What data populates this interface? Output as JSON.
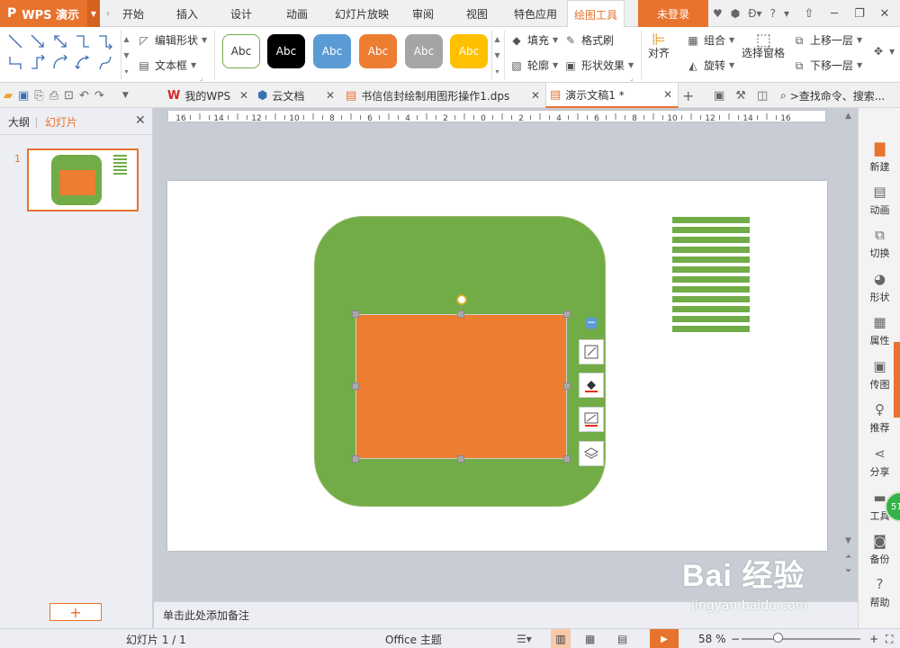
{
  "app": {
    "name": "WPS 演示",
    "logo": "P"
  },
  "menu": {
    "tabs": [
      "开始",
      "插入",
      "设计",
      "动画",
      "幻灯片放映",
      "审阅",
      "视图",
      "特色应用",
      "绘图工具"
    ],
    "login": "未登录",
    "help": "?"
  },
  "ribbon": {
    "edit_shape": "编辑形状",
    "text_box": "文本框",
    "style_label": "Abc",
    "fill": "填充",
    "outline": "轮廓",
    "format_painter": "格式刷",
    "shape_effect": "形状效果",
    "align": "对齐",
    "group": "组合",
    "rotate": "旋转",
    "selection_pane": "选择窗格",
    "bring_forward": "上移一层",
    "send_backward": "下移一层"
  },
  "doc_tabs": [
    {
      "label": "我的WPS"
    },
    {
      "label": "云文档"
    },
    {
      "label": "书信信封绘制用图形操作1.dps"
    },
    {
      "label": "演示文稿1 *"
    }
  ],
  "search": {
    "label": ">查找命令、搜索..."
  },
  "left_panel": {
    "tab_outline": "大纲",
    "tab_slides": "幻灯片",
    "slide_number": "1",
    "add_label": "+"
  },
  "notes": {
    "placeholder": "单击此处添加备注"
  },
  "right_bar": [
    "新建",
    "动画",
    "切换",
    "形状",
    "属性",
    "传图",
    "推荐",
    "分享",
    "工具",
    "备份",
    "帮助"
  ],
  "float_badge": "51",
  "status": {
    "slide_info": "幻灯片 1 / 1",
    "theme": "Office 主题",
    "zoom": "58 %"
  },
  "ruler": {
    "labels": [
      "16",
      "14",
      "12",
      "10",
      "8",
      "6",
      "4",
      "2",
      "0",
      "2",
      "4",
      "6",
      "8",
      "10",
      "12",
      "14",
      "16"
    ]
  },
  "watermark": {
    "brand": "Bai 经验",
    "url": "jingyan.baidu.com"
  },
  "colors": {
    "accent": "#e8732d",
    "green_shape": "#71ac47",
    "orange_shape": "#ed7d31"
  }
}
